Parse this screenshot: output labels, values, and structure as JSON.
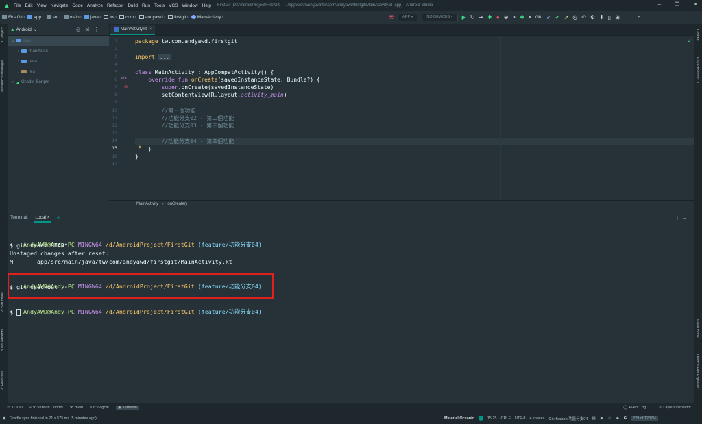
{
  "menubar": {
    "items": [
      "File",
      "Edit",
      "View",
      "Navigate",
      "Code",
      "Analyze",
      "Refactor",
      "Build",
      "Run",
      "Tools",
      "VCS",
      "Window",
      "Help"
    ],
    "title": "FirstGit [D:\\AndroidProject\\FirstGit] - ...\\app\\src\\main\\java\\tw\\com\\andyawd\\firstgit\\MainActivity.kt [app] - Android Studio"
  },
  "navbar": {
    "crumbs": [
      "FirstGit",
      "app",
      "src",
      "main",
      "java",
      "tw",
      "com",
      "andyawd",
      "firstgit",
      "MainActivity"
    ],
    "run_config": "APP",
    "device": "NO DEVICES",
    "git_label": "Git:"
  },
  "side_tabs": {
    "left": [
      "1: Project",
      "Resource Manager",
      "2: Structure",
      "Build Variants",
      "2: Favorites"
    ],
    "right": [
      "Gradle",
      "Key Promoter X",
      "Mood Book",
      "Device File Explorer"
    ]
  },
  "project": {
    "view_mode": "Android",
    "tree": [
      {
        "label": "app",
        "level": 0,
        "selected": true
      },
      {
        "label": "manifests",
        "level": 1
      },
      {
        "label": "java",
        "level": 1
      },
      {
        "label": "res",
        "level": 1
      },
      {
        "label": "Gradle Scripts",
        "level": 0
      }
    ]
  },
  "editor": {
    "tab": "MainActivity.kt",
    "line_numbers": [
      "1",
      "2",
      "3",
      "4",
      "5",
      "6",
      "7",
      "8",
      "9",
      "10",
      "11",
      "12",
      "13",
      "14",
      "15",
      "16",
      "17"
    ],
    "current_line": "15",
    "code": {
      "l1_kw": "package",
      "l1_rest": " tw.com.andyawd.firstgit",
      "l3_kw": "import",
      "l3_fold": "...",
      "l6_kw": "class",
      "l6_rest": " MainActivity : AppCompatActivity() {",
      "l7_kw": "    override fun",
      "l7_fn": " onCreate",
      "l7_rest": "(savedInstanceState: Bundle?) {",
      "l8_kw": "        super",
      "l8_rest": ".onCreate(savedInstanceState)",
      "l9_rest": "        setContentView(R.layout.",
      "l9_it": "activity_main",
      "l9_end": ")",
      "l11": "        //第一個功能",
      "l12": "        //功能分支02 - 第二個功能",
      "l13": "        //功能分支03 - 第三個功能",
      "l15": "        //功能分支04 - 第四個功能",
      "l16": "    }",
      "l17": "}"
    },
    "breadcrumb": [
      "MainActivity",
      "onCreate()"
    ]
  },
  "terminal": {
    "title": "Terminal:",
    "tab": "Local",
    "user": "AndyAWD@Andy-PC",
    "host": "MINGW64",
    "path": "/d/AndroidProject/FirstGit",
    "branch": "(feature/功能分支04)",
    "lines": {
      "cmd1": "$ git reset HEAD^",
      "out1": "Unstaged changes after reset:",
      "out2": "M       app/src/main/java/tw/com/andyawd/firstgit/MainActivity.kt",
      "cmd2": "$ git checkout -- .",
      "prompt": "$ "
    }
  },
  "tool_windows": {
    "left": [
      "TODO",
      "9: Version Control",
      "Build",
      "6: Logcat",
      "Terminal"
    ],
    "right": [
      "Event Log",
      "Layout Inspector"
    ]
  },
  "status": {
    "message": "Gradle sync finished in 21 s 575 ms (5 minutes ago)",
    "theme": "Material Oceanic",
    "position": "15:25",
    "line_sep": "CRLF",
    "encoding": "UTF-8",
    "indent": "4 spaces",
    "git_branch": "Git: feature/功能分支04",
    "memory": "229 of 1237M"
  }
}
